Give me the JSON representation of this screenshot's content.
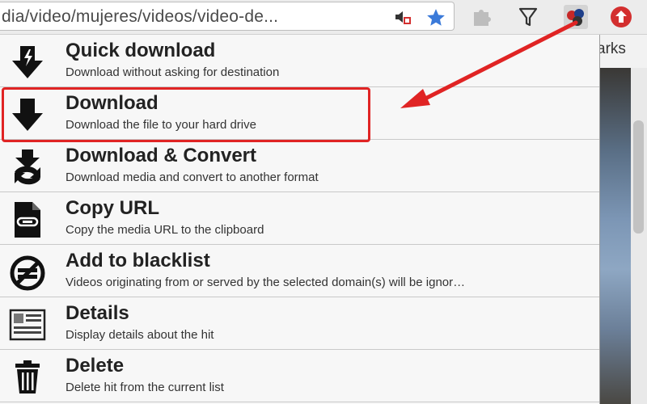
{
  "browser": {
    "url": "dia/video/mujeres/videos/video-de...",
    "bookmarks_fragment": "arks",
    "icons": [
      "media-capture-icon",
      "bookmark-star-icon",
      "puzzle-extension-icon",
      "funnel-icon",
      "video-downloadhelper-icon",
      "upload-circle-icon"
    ]
  },
  "menu": {
    "items": [
      {
        "title": "Quick download",
        "desc": "Download without asking for destination",
        "icon": "quick-download-icon"
      },
      {
        "title": "Download",
        "desc": "Download the file to your hard drive",
        "icon": "download-arrow-icon"
      },
      {
        "title": "Download & Convert",
        "desc": "Download media and convert to another format",
        "icon": "download-convert-icon"
      },
      {
        "title": "Copy URL",
        "desc": "Copy the media URL to the clipboard",
        "icon": "copy-url-icon"
      },
      {
        "title": "Add to blacklist",
        "desc": "Videos originating from or served by the selected domain(s) will be ignor…",
        "icon": "blacklist-icon"
      },
      {
        "title": "Details",
        "desc": "Display details about the hit",
        "icon": "details-icon"
      },
      {
        "title": "Delete",
        "desc": "Delete hit from the current list",
        "icon": "trash-icon"
      }
    ]
  },
  "annotation": {
    "highlight_color": "#e02424",
    "arrow_color": "#e02424"
  }
}
